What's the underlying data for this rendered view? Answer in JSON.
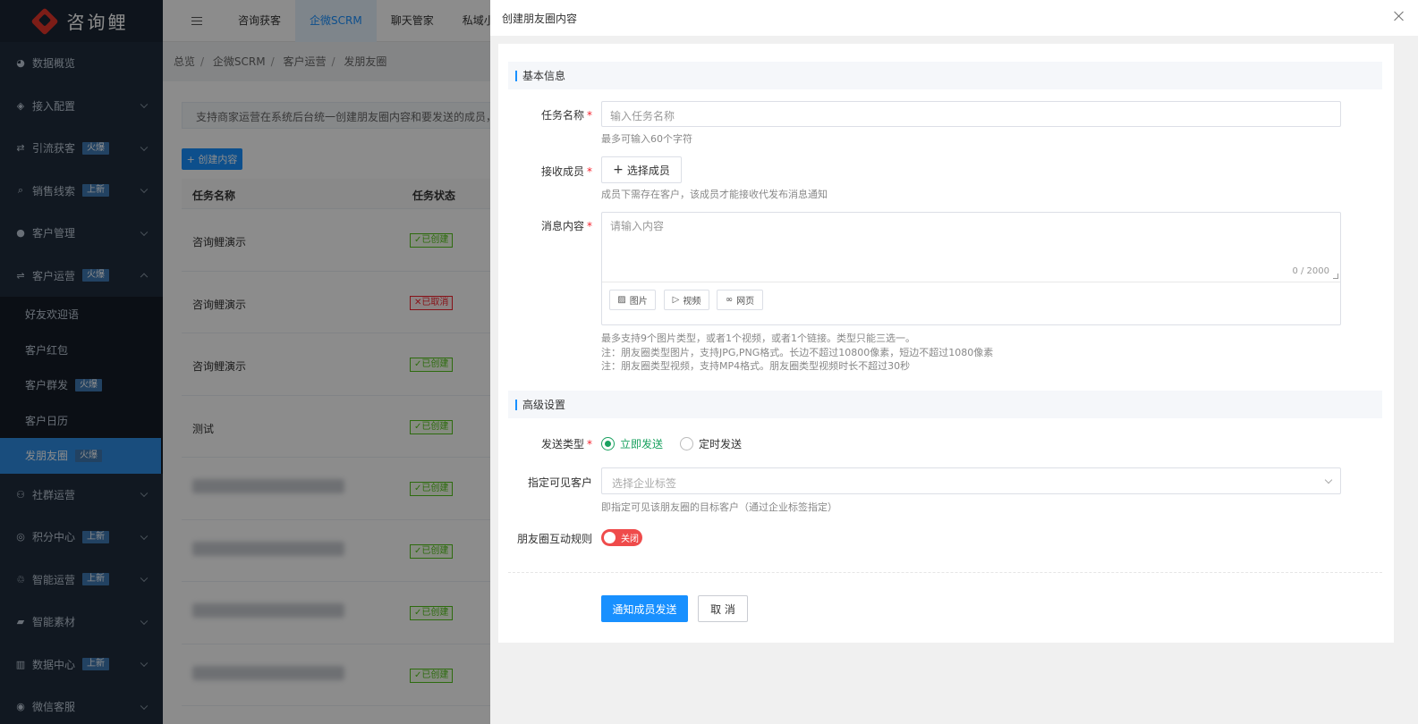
{
  "app": {
    "logo_text": "咨询鲤"
  },
  "sidebar": {
    "items": [
      {
        "label": "数据概览",
        "icon": "pie-chart-icon"
      },
      {
        "label": "接入配置",
        "icon": "cube-icon"
      },
      {
        "label": "引流获客",
        "icon": "swap-icon",
        "badge": "火爆"
      },
      {
        "label": "销售线索",
        "icon": "search-icon",
        "badge": "上新"
      },
      {
        "label": "客户管理",
        "icon": "user-icon"
      },
      {
        "label": "客户运营",
        "icon": "share-icon",
        "badge": "火爆"
      }
    ],
    "subitems": [
      {
        "label": "好友欢迎语"
      },
      {
        "label": "客户红包"
      },
      {
        "label": "客户群发",
        "badge": "火爆"
      },
      {
        "label": "客户日历"
      },
      {
        "label": "发朋友圈",
        "badge": "火爆"
      }
    ],
    "items_after": [
      {
        "label": "社群运营",
        "icon": "group-icon"
      },
      {
        "label": "积分中心",
        "icon": "coins-icon",
        "badge": "上新"
      },
      {
        "label": "智能运营",
        "icon": "robot-icon",
        "badge": "上新"
      },
      {
        "label": "智能素材",
        "icon": "folder-icon"
      },
      {
        "label": "数据中心",
        "icon": "bar-chart-icon",
        "badge": "上新"
      },
      {
        "label": "微信客服",
        "icon": "chat-icon"
      }
    ]
  },
  "topnav": {
    "tabs": [
      "咨询获客",
      "企微SCRM",
      "聊天管家",
      "私域小"
    ]
  },
  "breadcrumb": [
    "总览",
    "企微SCRM",
    "客户运营",
    "发朋友圈"
  ],
  "page": {
    "notice": "支持商家运营在系统后台统一创建朋友圈内容和要发送的成员，并进",
    "create_btn": "+ 创建内容",
    "table": {
      "headers": [
        "任务名称",
        "任务状态"
      ],
      "rows": [
        {
          "name": "咨询鲤演示",
          "status": "✓已创建",
          "cancel": false
        },
        {
          "name": "咨询鲤演示",
          "status": "✕已取消",
          "cancel": true
        },
        {
          "name": "咨询鲤演示",
          "status": "✓已创建",
          "cancel": false
        },
        {
          "name": "测试",
          "status": "✓已创建",
          "cancel": false
        },
        {
          "name": "",
          "status": "✓已创建",
          "cancel": false,
          "blur": true
        },
        {
          "name": "",
          "status": "✓已创建",
          "cancel": false,
          "blur": true
        },
        {
          "name": "",
          "status": "✓已创建",
          "cancel": false,
          "blur": true
        },
        {
          "name": "",
          "status": "✓已创建",
          "cancel": false,
          "blur": true
        }
      ]
    }
  },
  "drawer": {
    "title": "创建朋友圈内容",
    "basic_title": "基本信息",
    "task_name_label": "任务名称",
    "task_name_placeholder": "输入任务名称",
    "task_name_hint": "最多可输入60个字符",
    "receiver_label": "接收成员",
    "receiver_btn": "选择成员",
    "receiver_hint": "成员下需存在客户，该成员才能接收代发布消息通知",
    "message_label": "消息内容",
    "message_placeholder": "请输入内容",
    "message_counter": "0 / 2000",
    "media": {
      "image": "图片",
      "video": "视频",
      "link": "网页"
    },
    "media_hints": [
      "最多支持9个图片类型，或者1个视频，或者1个链接。类型只能三选一。",
      "注：朋友圈类型图片，支持JPG,PNG格式。长边不超过10800像素，短边不超过1080像素",
      "注：朋友圈类型视频，支持MP4格式。朋友圈类型视频时长不超过30秒"
    ],
    "advanced_title": "高级设置",
    "send_type_label": "发送类型",
    "send_now": "立即发送",
    "send_scheduled": "定时发送",
    "visible_label": "指定可见客户",
    "visible_placeholder": "选择企业标签",
    "visible_hint": "即指定可见该朋友圈的目标客户（通过企业标签指定）",
    "interact_label": "朋友圈互动规则",
    "switch_text": "关闭",
    "submit_btn": "通知成员发送",
    "cancel_btn": "取 消"
  },
  "colors": {
    "primary": "#1890ff",
    "success": "#19a15f",
    "danger": "#ef4b4b",
    "sidebar": "#1f2d3d"
  }
}
